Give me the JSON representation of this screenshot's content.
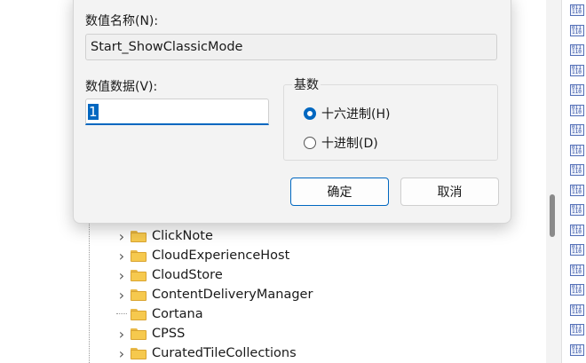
{
  "dialog": {
    "name_label": "数值名称(N):",
    "name_value": "Start_ShowClassicMode",
    "data_label": "数值数据(V):",
    "data_value": "1",
    "base": {
      "title": "基数",
      "options": [
        {
          "label": "十六进制(H)",
          "selected": true
        },
        {
          "label": "十进制(D)",
          "selected": false
        }
      ]
    },
    "ok_label": "确定",
    "cancel_label": "取消"
  },
  "tree": {
    "items": [
      {
        "label": "ClickNote",
        "expandable": true
      },
      {
        "label": "CloudExperienceHost",
        "expandable": true
      },
      {
        "label": "CloudStore",
        "expandable": true
      },
      {
        "label": "ContentDeliveryManager",
        "expandable": true
      },
      {
        "label": "Cortana",
        "expandable": false
      },
      {
        "label": "CPSS",
        "expandable": true
      },
      {
        "label": "CuratedTileCollections",
        "expandable": true
      }
    ]
  },
  "values_pane": {
    "icon": "reg-dword-icon",
    "icon_glyph": "011\n110"
  },
  "colors": {
    "accent": "#0067c0",
    "folder": "#f6c94e"
  }
}
